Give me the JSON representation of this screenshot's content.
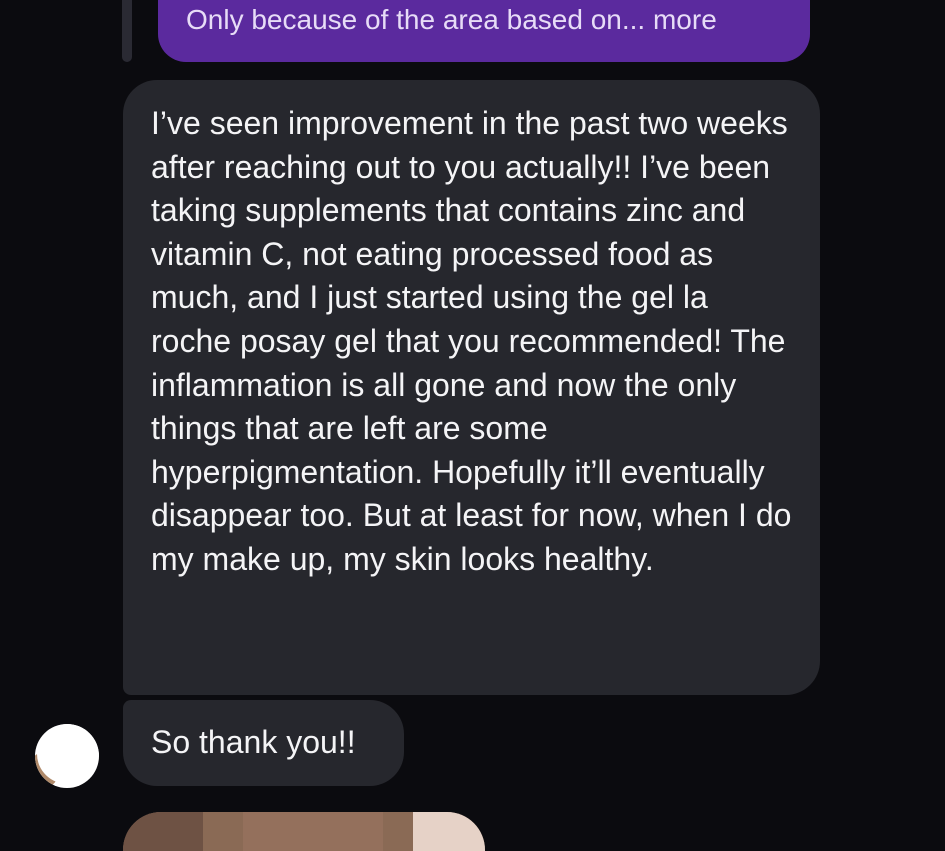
{
  "thread": {
    "quoted_reply": {
      "text": "Only because of the area based on... more"
    },
    "messages": [
      {
        "text": "I’ve seen improvement in the past two weeks after reaching out to you actually!! I’ve been taking supplements that contains zinc and vitamin C, not eating processed food as much, and I just started using the gel la roche posay gel that you recommended! The inflammation is all gone and now the only things that are left are some hyperpigmentation. Hopefully it’ll eventually disappear too. But at least for now, when I do my make up, my skin looks healthy."
      },
      {
        "text": "So thank you!!"
      }
    ]
  },
  "colors": {
    "background": "#0b0b0f",
    "incoming_bubble": "#26272d",
    "quoted_bubble": "#5b2a9e",
    "text": "#f4f4f6"
  },
  "icons": {
    "avatar": "sender-avatar",
    "image": "photo-attachment"
  }
}
